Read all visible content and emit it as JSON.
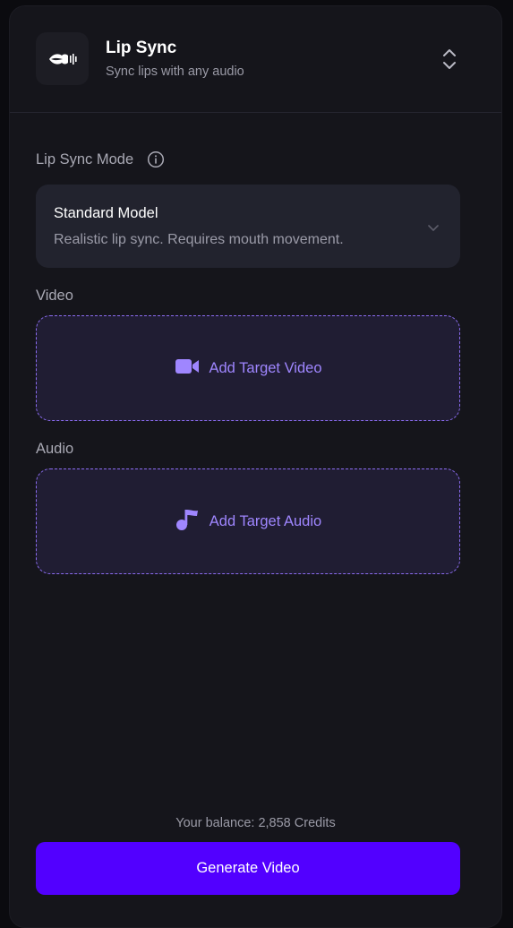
{
  "header": {
    "title": "Lip Sync",
    "subtitle": "Sync lips with any audio",
    "logo_icon": "lips-waveform-icon",
    "switch_icon": "chevron-up-down-icon"
  },
  "mode": {
    "label": "Lip Sync Mode",
    "selected_title": "Standard Model",
    "selected_description": "Realistic lip sync. Requires mouth movement."
  },
  "video": {
    "label": "Video",
    "add_label": "Add Target Video",
    "icon": "video-camera-icon"
  },
  "audio": {
    "label": "Audio",
    "add_label": "Add Target Audio",
    "icon": "music-note-icon"
  },
  "footer": {
    "balance": "Your balance: 2,858 Credits",
    "generate_label": "Generate Video"
  },
  "colors": {
    "accent": "#5200ff",
    "accent_text": "#9f86ff",
    "panel": "#15151b"
  }
}
